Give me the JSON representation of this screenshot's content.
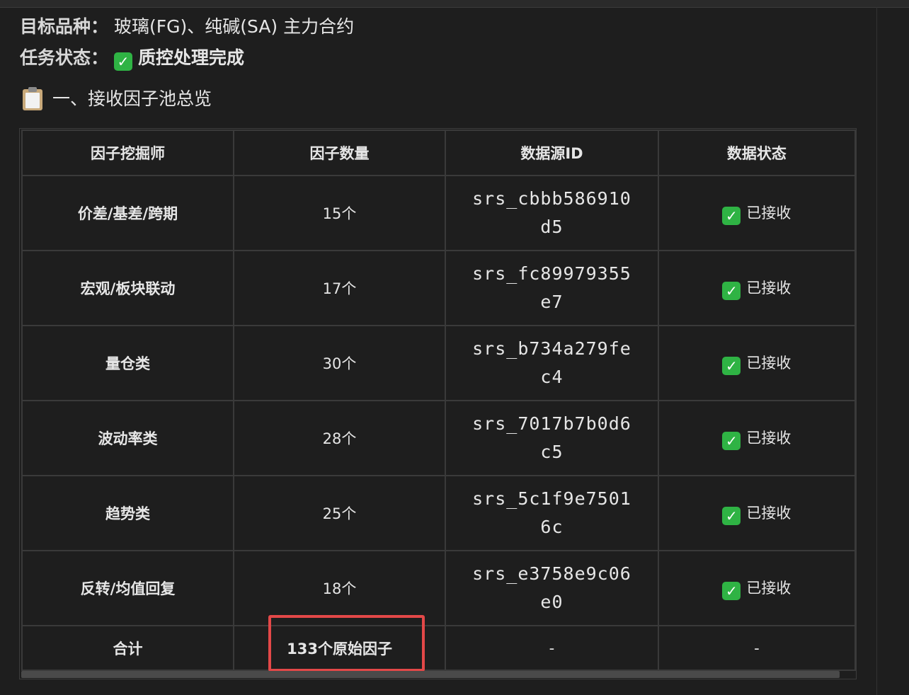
{
  "target": {
    "label": "目标品种：",
    "value": "玻璃(FG)、纯碱(SA) 主力合约"
  },
  "task": {
    "label": "任务状态：",
    "value": "质控处理完成"
  },
  "section": {
    "title": "一、接收因子池总览"
  },
  "table": {
    "headers": [
      "因子挖掘师",
      "因子数量",
      "数据源ID",
      "数据状态"
    ],
    "rows": [
      {
        "miner": "价差/基差/跨期",
        "count": "15个",
        "source_id": "srs_cbbb586910d5",
        "status": "已接收"
      },
      {
        "miner": "宏观/板块联动",
        "count": "17个",
        "source_id": "srs_fc89979355e7",
        "status": "已接收"
      },
      {
        "miner": "量仓类",
        "count": "30个",
        "source_id": "srs_b734a279fec4",
        "status": "已接收"
      },
      {
        "miner": "波动率类",
        "count": "28个",
        "source_id": "srs_7017b7b0d6c5",
        "status": "已接收"
      },
      {
        "miner": "趋势类",
        "count": "25个",
        "source_id": "srs_5c1f9e75016c",
        "status": "已接收"
      },
      {
        "miner": "反转/均值回复",
        "count": "18个",
        "source_id": "srs_e3758e9c06e0",
        "status": "已接收"
      }
    ],
    "total": {
      "label": "合计",
      "count": "133个原始因子",
      "source_id": "-",
      "status": "-"
    }
  },
  "icons": {
    "check": "check-mark-icon",
    "clipboard": "clipboard-icon"
  },
  "colors": {
    "check_green": "#2fb344",
    "highlight_red": "#e34848",
    "background": "#1e1e1e"
  }
}
